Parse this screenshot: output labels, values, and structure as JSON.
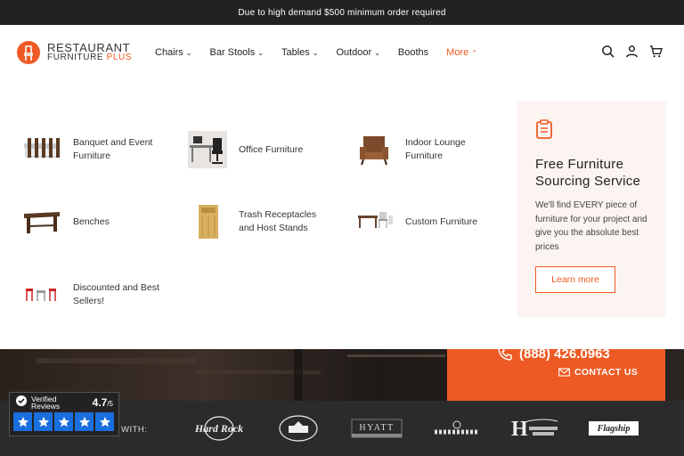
{
  "announcement": "Due to high demand $500 minimum order required",
  "logo": {
    "line1": "RESTAURANT",
    "line2a": "FURNITURE ",
    "line2b": "PLUS"
  },
  "nav": [
    {
      "label": "Chairs",
      "chev": "⌄"
    },
    {
      "label": "Bar Stools",
      "chev": "⌄"
    },
    {
      "label": "Tables",
      "chev": "⌄"
    },
    {
      "label": "Outdoor",
      "chev": "⌄"
    },
    {
      "label": "Booths",
      "chev": ""
    },
    {
      "label": "More",
      "chev": "⌃"
    }
  ],
  "categories": [
    {
      "label": "Banquet and Event Furniture"
    },
    {
      "label": "Office Furniture"
    },
    {
      "label": "Indoor Lounge Furniture"
    },
    {
      "label": "Benches"
    },
    {
      "label": "Trash Receptacles and Host Stands"
    },
    {
      "label": "Custom Furniture"
    },
    {
      "label": "Discounted and Best Sellers!"
    }
  ],
  "promo": {
    "title": "Free Furniture Sourcing Service",
    "text": "We'll find EVERY piece of furniture for your project and give you the absolute best prices",
    "button": "Learn more"
  },
  "contact": {
    "phone": "(888) 426.0963",
    "cta": "CONTACT US"
  },
  "trust": {
    "with": "WITH:"
  },
  "reviews": {
    "brand": "Verified Reviews",
    "score": "4.7",
    "out_of": "/5"
  },
  "colors": {
    "accent": "#ee5a24",
    "dark": "#222222",
    "promo_bg": "#fbf4f0",
    "star_blue": "#1a6fe0"
  },
  "brands": [
    "Hard Rock",
    "The White House",
    "HYATT",
    "Banquet",
    "Holiday Inn Resort",
    "Flagship Restaurant Group"
  ]
}
